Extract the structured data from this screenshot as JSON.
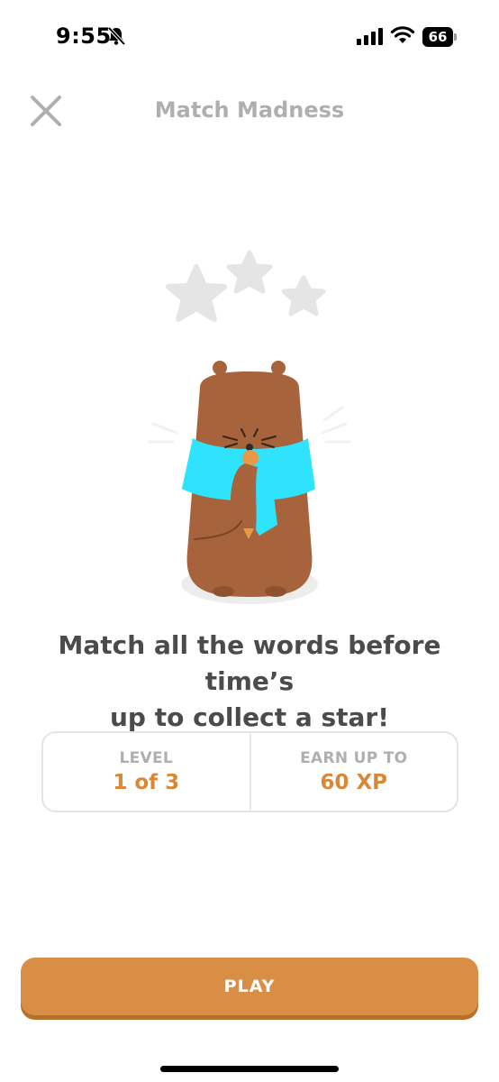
{
  "status_bar": {
    "time": "9:55",
    "battery": "66",
    "icons": [
      "bell-off-icon",
      "signal-icon",
      "wifi-icon",
      "battery-icon"
    ]
  },
  "header": {
    "title": "Match Madness",
    "close_icon": "close-icon"
  },
  "illustration": {
    "stars_earned": 0,
    "stars_total": 3,
    "colors": {
      "star_empty": "#e5e5e5",
      "fur": "#a7633b",
      "scarf": "#2ee3fb"
    }
  },
  "prompt": {
    "line1": "Match all the words before time’s",
    "line2": "up to collect a star!"
  },
  "info": {
    "level_label": "LEVEL",
    "level_value": "1 of 3",
    "xp_label": "EARN UP TO",
    "xp_value": "60 XP"
  },
  "play_button": {
    "label": "PLAY",
    "color": "#d98e45"
  }
}
